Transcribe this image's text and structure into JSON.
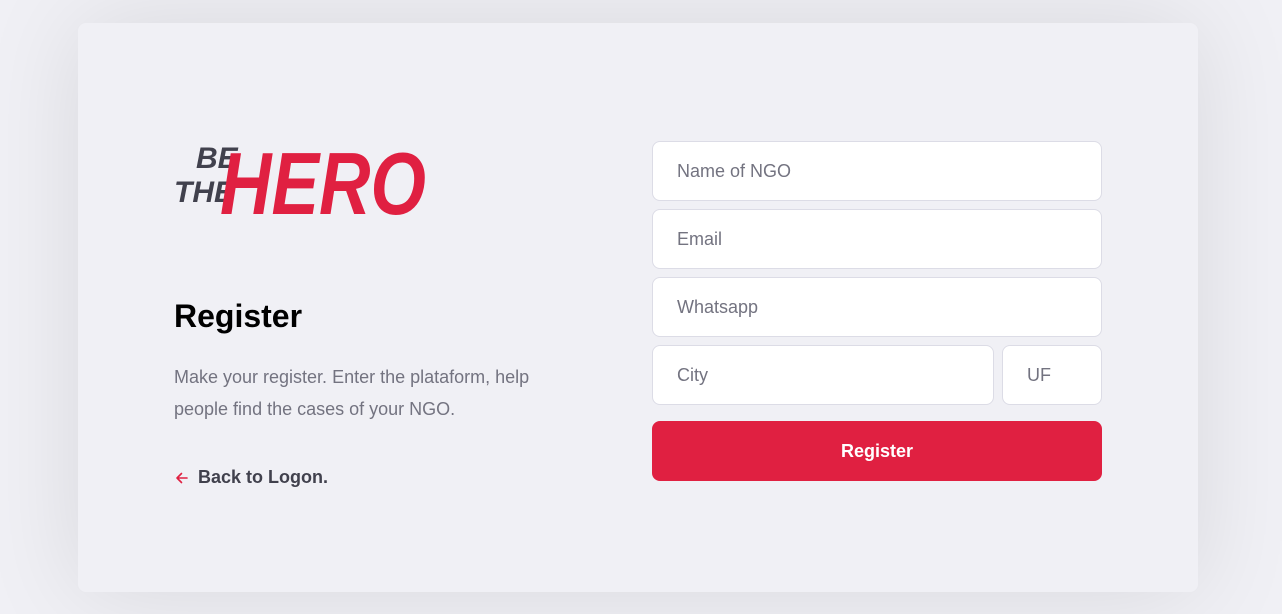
{
  "brand": {
    "logo_text_small_1": "BE",
    "logo_text_small_2": "THE",
    "logo_text_big": "HERO",
    "accent_color": "#e02041",
    "dark_color": "#41414d"
  },
  "page": {
    "title": "Register",
    "description": "Make your register. Enter the plataform, help people find the cases of your NGO.",
    "back_link_label": "Back to Logon.",
    "back_icon": "arrow-left-icon"
  },
  "form": {
    "name_placeholder": "Name of NGO",
    "email_placeholder": "Email",
    "whatsapp_placeholder": "Whatsapp",
    "city_placeholder": "City",
    "uf_placeholder": "UF",
    "submit_label": "Register"
  }
}
